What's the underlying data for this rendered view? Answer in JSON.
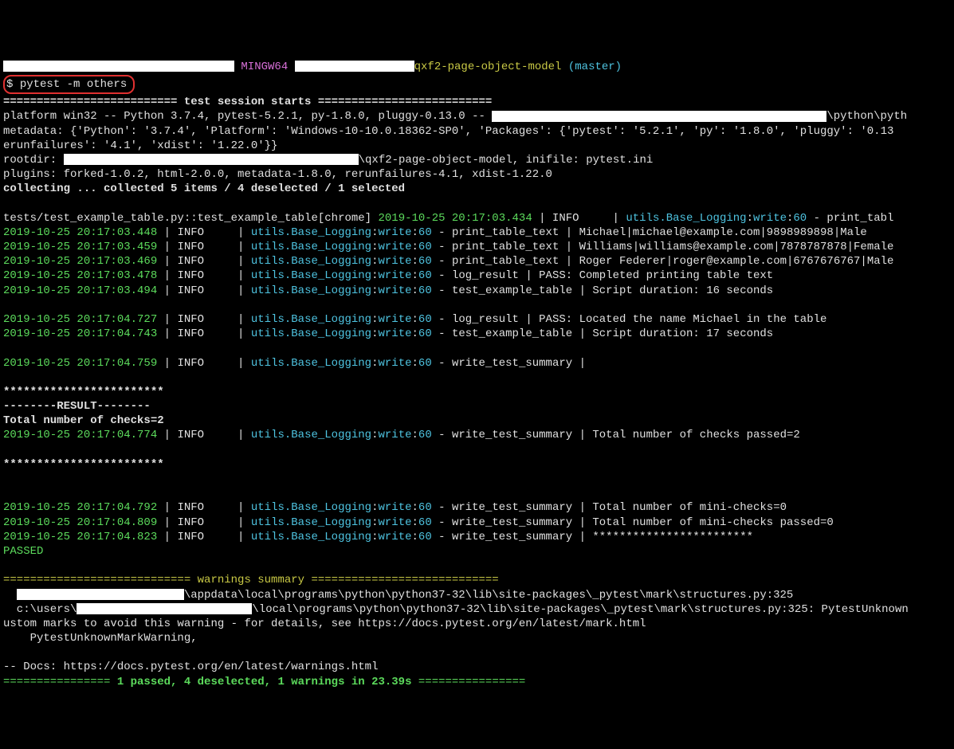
{
  "prompt": {
    "mingw": "MINGW64",
    "path_suffix": "qxf2-page-object-model",
    "branch": "(master)",
    "dollar": "$",
    "command": "pytest -m others"
  },
  "session": {
    "header_eq": "========================== test session starts ==========================",
    "platform": "platform win32 -- Python 3.7.4, pytest-5.2.1, py-1.8.0, pluggy-0.13.0 -- ",
    "platform_suffix": "\\python\\pyth",
    "metadata": "metadata: {'Python': '3.7.4', 'Platform': 'Windows-10-10.0.18362-SP0', 'Packages': {'pytest': '5.2.1', 'py': '1.8.0', 'pluggy': '0.13",
    "rerun": "erunfailures': '4.1', 'xdist': '1.22.0'}}",
    "rootdir_prefix": "rootdir: ",
    "rootdir_suffix": "\\qxf2-page-object-model, inifile: pytest.ini",
    "plugins": "plugins: forked-1.0.2, html-2.0.0, metadata-1.8.0, rerunfailures-4.1, xdist-1.22.0",
    "collecting": "collecting ... collected 5 items / 4 deselected / 1 selected"
  },
  "test_line": {
    "prefix": "tests/test_example_table.py::test_example_table[chrome] ",
    "ts": "2019-10-25 20:17:03.434",
    "info": " | INFO     | ",
    "util": "utils.Base_Logging",
    "colon": ":",
    "write": "write",
    "sixty": "60",
    "suffix": " - print_tabl"
  },
  "logs": [
    {
      "ts": "2019-10-25 20:17:03.448",
      "msg": " - print_table_text | Michael|michael@example.com|9898989898|Male"
    },
    {
      "ts": "2019-10-25 20:17:03.459",
      "msg": " - print_table_text | Williams|williams@example.com|7878787878|Female"
    },
    {
      "ts": "2019-10-25 20:17:03.469",
      "msg": " - print_table_text | Roger Federer|roger@example.com|6767676767|Male"
    },
    {
      "ts": "2019-10-25 20:17:03.478",
      "msg": " - log_result | PASS: Completed printing table text"
    },
    {
      "ts": "2019-10-25 20:17:03.494",
      "msg": " - test_example_table | Script duration: 16 seconds"
    }
  ],
  "logs2": [
    {
      "ts": "2019-10-25 20:17:04.727",
      "msg": " - log_result | PASS: Located the name Michael in the table"
    },
    {
      "ts": "2019-10-25 20:17:04.743",
      "msg": " - test_example_table | Script duration: 17 seconds"
    }
  ],
  "log_single": {
    "ts": "2019-10-25 20:17:04.759",
    "msg": " - write_test_summary |"
  },
  "info_token": " | INFO     | ",
  "util_pre": "utils.Base_Logging",
  "write_tok": "write",
  "sixty_tok": "60",
  "stars": "************************",
  "result_header": "--------RESULT--------",
  "total_checks": "Total number of checks=2",
  "log_passed": {
    "ts": "2019-10-25 20:17:04.774",
    "msg": " - write_test_summary | Total number of checks passed=2"
  },
  "logs3": [
    {
      "ts": "2019-10-25 20:17:04.792",
      "msg": " - write_test_summary | Total number of mini-checks=0"
    },
    {
      "ts": "2019-10-25 20:17:04.809",
      "msg": " - write_test_summary | Total number of mini-checks passed=0"
    },
    {
      "ts": "2019-10-25 20:17:04.823",
      "msg": " - write_test_summary | ************************"
    }
  ],
  "passed": "PASSED",
  "warnings": {
    "header": "============================ warnings summary ============================",
    "line1_prefix": "  ",
    "line1_suffix": "\\appdata\\local\\programs\\python\\python37-32\\lib\\site-packages\\_pytest\\mark\\structures.py:325",
    "line2_prefix": "  c:\\users\\",
    "line2_suffix": "\\local\\programs\\python\\python37-32\\lib\\site-packages\\_pytest\\mark\\structures.py:325: PytestUnknown",
    "line3": "ustom marks to avoid this warning - for details, see https://docs.pytest.org/en/latest/mark.html",
    "line4": "    PytestUnknownMarkWarning,",
    "docs": "-- Docs: https://docs.pytest.org/en/latest/warnings.html",
    "footer_eq_left": "================ ",
    "footer_text": "1 passed, 4 deselected, 1 warnings in 23.39s",
    "footer_eq_right": " ================"
  }
}
